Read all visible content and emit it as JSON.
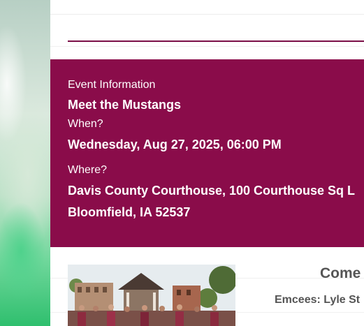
{
  "event": {
    "section_label": "Event Information",
    "title": "Meet the Mustangs",
    "when_label": "When?",
    "when_value": "Wednesday, Aug 27, 2025, 06:00 PM",
    "where_label": "Where?",
    "where_line1": "Davis County Courthouse, 100 Courthouse Sq L",
    "where_line2": "Bloomfield, IA 52537"
  },
  "details": {
    "heading_partial": "Come",
    "emcees_partial": "Emcees: Lyle St"
  },
  "colors": {
    "event_panel_bg": "#8a0c4a",
    "accent_rule": "#7a0e46"
  }
}
